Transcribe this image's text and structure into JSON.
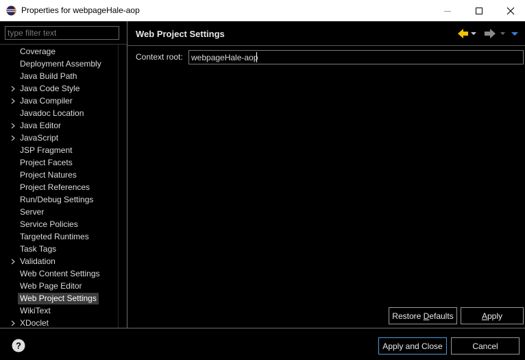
{
  "window": {
    "title": "Properties for webpageHale-aop",
    "minimize_icon": "minimize-icon",
    "maximize_icon": "maximize-icon",
    "close_icon": "close-icon"
  },
  "filter": {
    "placeholder": "type filter text",
    "value": ""
  },
  "tree": {
    "items": [
      {
        "label": "Coverage",
        "expandable": false,
        "selected": false
      },
      {
        "label": "Deployment Assembly",
        "expandable": false,
        "selected": false
      },
      {
        "label": "Java Build Path",
        "expandable": false,
        "selected": false
      },
      {
        "label": "Java Code Style",
        "expandable": true,
        "selected": false
      },
      {
        "label": "Java Compiler",
        "expandable": true,
        "selected": false
      },
      {
        "label": "Javadoc Location",
        "expandable": false,
        "selected": false
      },
      {
        "label": "Java Editor",
        "expandable": true,
        "selected": false
      },
      {
        "label": "JavaScript",
        "expandable": true,
        "selected": false
      },
      {
        "label": "JSP Fragment",
        "expandable": false,
        "selected": false
      },
      {
        "label": "Project Facets",
        "expandable": false,
        "selected": false
      },
      {
        "label": "Project Natures",
        "expandable": false,
        "selected": false
      },
      {
        "label": "Project References",
        "expandable": false,
        "selected": false
      },
      {
        "label": "Run/Debug Settings",
        "expandable": false,
        "selected": false
      },
      {
        "label": "Server",
        "expandable": false,
        "selected": false
      },
      {
        "label": "Service Policies",
        "expandable": false,
        "selected": false
      },
      {
        "label": "Targeted Runtimes",
        "expandable": false,
        "selected": false
      },
      {
        "label": "Task Tags",
        "expandable": false,
        "selected": false
      },
      {
        "label": "Validation",
        "expandable": true,
        "selected": false
      },
      {
        "label": "Web Content Settings",
        "expandable": false,
        "selected": false
      },
      {
        "label": "Web Page Editor",
        "expandable": false,
        "selected": false
      },
      {
        "label": "Web Project Settings",
        "expandable": false,
        "selected": true
      },
      {
        "label": "WikiText",
        "expandable": false,
        "selected": false
      },
      {
        "label": "XDoclet",
        "expandable": true,
        "selected": false
      }
    ]
  },
  "page": {
    "title": "Web Project Settings",
    "context_root_label": "Context root:",
    "context_root_value": "webpageHale-aop"
  },
  "buttons": {
    "restore_defaults_pre": "Restore ",
    "restore_defaults_mnemonic": "D",
    "restore_defaults_post": "efaults",
    "apply_mnemonic": "A",
    "apply_post": "pply",
    "apply_and_close": "Apply and Close",
    "cancel": "Cancel"
  },
  "colors": {
    "back_arrow": "#f2c200",
    "forward_arrow": "#8a8a8a",
    "menu_arrow": "#3f7fdc",
    "focus_border": "#4e9bd6"
  }
}
